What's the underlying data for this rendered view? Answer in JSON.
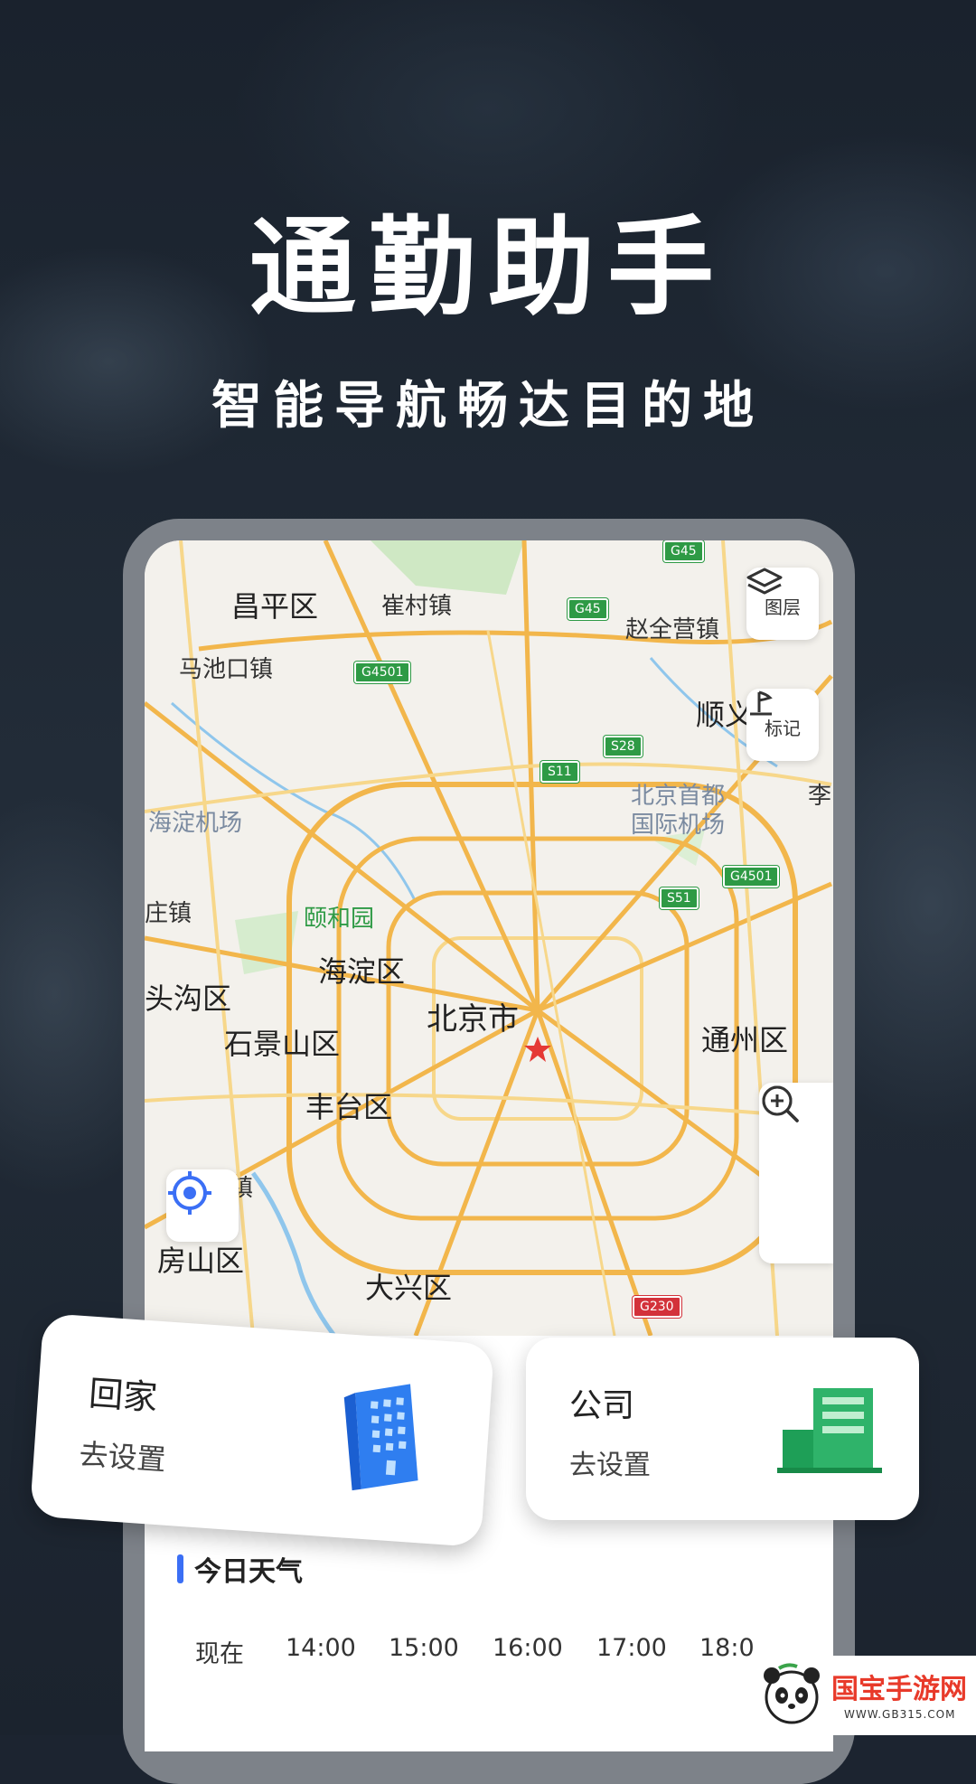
{
  "hero": {
    "title": "通勤助手",
    "subtitle": "智能导航畅达目的地"
  },
  "map": {
    "labels": {
      "changping": "昌平区",
      "cuicun": "崔村镇",
      "zhaoquanying": "赵全营镇",
      "machikou": "马池口镇",
      "shunyi": "顺义",
      "haidian_airport": "海淀机场",
      "capital_airport_1": "北京首都",
      "capital_airport_2": "国际机场",
      "li": "李",
      "zhuang": "庄镇",
      "yiheyuan": "颐和园",
      "haidian": "海淀区",
      "toutougou": "头沟区",
      "beijing": "北京市",
      "tongzhou": "通州区",
      "shijingshan": "石景山区",
      "fengtai": "丰台区",
      "zhen": "镇",
      "fangshan": "房山区",
      "daxing": "大兴区"
    },
    "shields": {
      "g45_top": "G45",
      "g45": "G45",
      "g4501_left": "G4501",
      "s28": "S28",
      "s11": "S11",
      "g4501_right": "G4501",
      "s51": "S51",
      "g230": "G230"
    },
    "controls": {
      "layers_label": "图层",
      "mark_label": "标记"
    }
  },
  "cards": {
    "home": {
      "title": "回家",
      "action": "去设置"
    },
    "office": {
      "title": "公司",
      "action": "去设置"
    }
  },
  "weather": {
    "title": "今日天气",
    "times": [
      "现在",
      "14:00",
      "15:00",
      "16:00",
      "17:00",
      "18:0"
    ]
  },
  "watermark": {
    "brand": "国宝手游网",
    "url": "WWW.GB315.COM"
  },
  "colors": {
    "accent": "#3b6ff5",
    "road_major": "#f2b64b",
    "road_minor": "#f7d78a",
    "shield_green": "#2e9a45",
    "office_green": "#2fb36a",
    "home_blue": "#2f7ef0"
  }
}
